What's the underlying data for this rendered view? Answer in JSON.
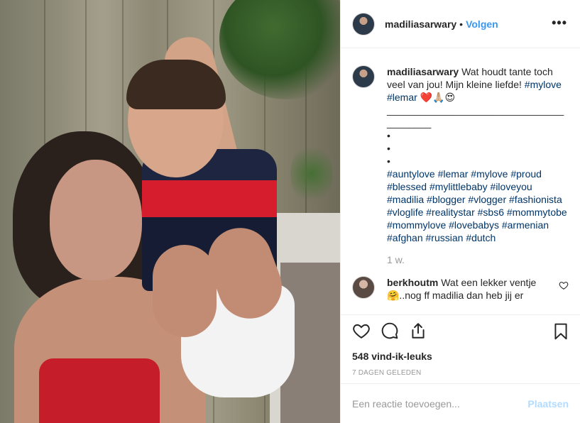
{
  "header": {
    "username": "madiliasarwary",
    "separator": "•",
    "follow_label": "Volgen",
    "more_label": "•••",
    "avatar_icon": "user-avatar"
  },
  "caption": {
    "username": "madiliasarwary",
    "text": "Wat houdt tante toch veel van jou! Mijn kleine liefde!",
    "inline_tags": [
      "#mylove",
      "#lemar"
    ],
    "emoji": "❤️🙏🏼😍",
    "divider": "________________________________________",
    "bullets": [
      "•",
      "•",
      "•"
    ],
    "hashtags": [
      "#auntylove",
      "#lemar",
      "#mylove",
      "#proud",
      "#blessed",
      "#mylittlebaby",
      "#iloveyou",
      "#madilia",
      "#blogger",
      "#vlogger",
      "#fashionista",
      "#vloglife",
      "#realitystar",
      "#sbs6",
      "#mommytobe",
      "#mommylove",
      "#lovebabys",
      "#armenian",
      "#afghan",
      "#russian",
      "#dutch"
    ],
    "time": "1 w."
  },
  "reply": {
    "username": "berkhoutm",
    "text": "Wat een lekker ventje",
    "text2": "🤗..nog ff madilia dan heb jij er"
  },
  "actions": {
    "like_icon": "heart-outline",
    "comment_icon": "speech-bubble",
    "share_icon": "share-upload",
    "save_icon": "bookmark"
  },
  "stats": {
    "likes": "548 vind-ik-leuks",
    "date": "7 DAGEN GELEDEN"
  },
  "add_comment": {
    "placeholder": "Een reactie toevoegen...",
    "post_label": "Plaatsen"
  },
  "colors": {
    "link": "#3897f0",
    "hashtag": "#003569",
    "muted": "#999999",
    "border": "#efefef",
    "post_disabled": "#b3dbff"
  }
}
